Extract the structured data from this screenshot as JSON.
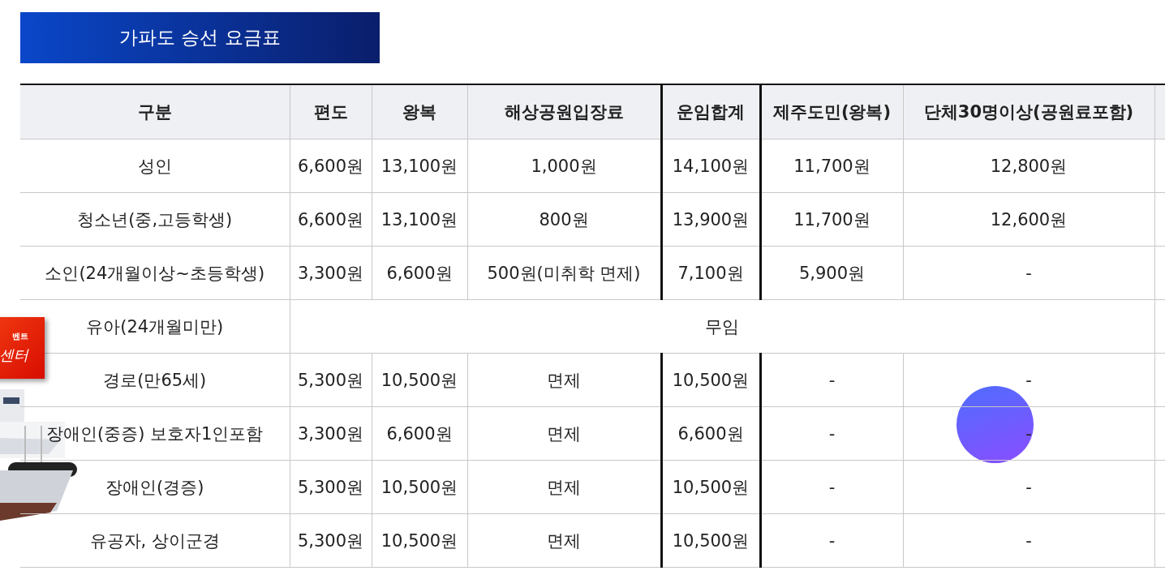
{
  "title": "가파도 승선 요금표",
  "table": {
    "columns": [
      "구분",
      "편도",
      "왕복",
      "해상공원입장료",
      "운임합계",
      "제주도민(왕복)",
      "단체30명이상(공원료포함)"
    ],
    "rows": [
      {
        "kind": "fares",
        "cells": [
          "성인",
          "6,600원",
          "13,100원",
          "1,000원",
          "14,100원",
          "11,700원",
          "12,800원"
        ]
      },
      {
        "kind": "fares",
        "cells": [
          "청소년(중,고등학생)",
          "6,600원",
          "13,100원",
          "800원",
          "13,900원",
          "11,700원",
          "12,600원"
        ]
      },
      {
        "kind": "fares",
        "cells": [
          "소인(24개월이상~초등학생)",
          "3,300원",
          "6,600원",
          "500원(미취학 면제)",
          "7,100원",
          "5,900원",
          "-"
        ]
      },
      {
        "kind": "merged",
        "cells": [
          "유아(24개월미만)",
          {
            "text": "무임",
            "colspan": 6
          }
        ]
      },
      {
        "kind": "fares",
        "cells": [
          "경로(만65세)",
          "5,300원",
          "10,500원",
          "면제",
          "10,500원",
          "-",
          "-"
        ]
      },
      {
        "kind": "fares",
        "cells": [
          "장애인(중증) 보호자1인포함",
          "3,300원",
          "6,600원",
          "면제",
          "6,600원",
          "-",
          "-"
        ]
      },
      {
        "kind": "fares",
        "cells": [
          "장애인(경증)",
          "5,300원",
          "10,500원",
          "면제",
          "10,500원",
          "-",
          "-"
        ]
      },
      {
        "kind": "fares",
        "cells": [
          "유공자, 상이군경",
          "5,300원",
          "10,500원",
          "면제",
          "10,500원",
          "-",
          "-"
        ]
      }
    ]
  },
  "side_banner": {
    "small_text": "벤트",
    "large_text": "센터"
  }
}
